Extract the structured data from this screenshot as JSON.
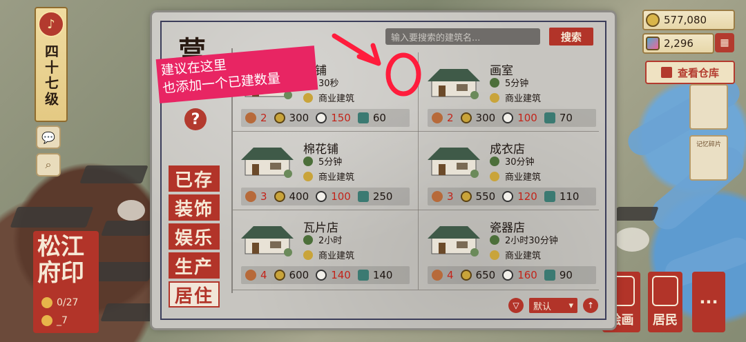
{
  "level": {
    "text": "四十七级"
  },
  "seal": {
    "title": "松江府印",
    "pop": "0/27",
    "other": "_7"
  },
  "resources": {
    "coins": "577,080",
    "gems": "2,296"
  },
  "warehouse": {
    "label": "查看仓库"
  },
  "right_cards": {
    "card2": "记忆碎片"
  },
  "bottom_buttons": {
    "paint": "绘画",
    "residents": "居民",
    "more": "···"
  },
  "panel": {
    "category_title": "营",
    "help": "?",
    "search_placeholder": "输入要搜索的建筑名...",
    "search_button": "搜索",
    "sort_label": "默认",
    "tabs": [
      "已存",
      "装饰",
      "娱乐",
      "生产",
      "居住"
    ]
  },
  "annotation": {
    "text": "建议在这里\n也添加一个已建数量"
  },
  "colors": {
    "accent": "#b23429",
    "annotation": "#e82563"
  },
  "cards": [
    {
      "name": "具铺",
      "time": "30秒",
      "type": "商业建筑",
      "workers": "2",
      "coins": "300",
      "bowls": "150",
      "item": "60",
      "item_icon": "ruler-icon"
    },
    {
      "name": "画室",
      "time": "5分钟",
      "type": "商业建筑",
      "workers": "2",
      "coins": "300",
      "bowls": "100",
      "item": "70",
      "item_icon": "scroll-icon"
    },
    {
      "name": "棉花铺",
      "time": "5分钟",
      "type": "商业建筑",
      "workers": "3",
      "coins": "400",
      "bowls": "100",
      "item": "250",
      "item_icon": "cotton-icon"
    },
    {
      "name": "成衣店",
      "time": "30分钟",
      "type": "商业建筑",
      "workers": "3",
      "coins": "550",
      "bowls": "120",
      "item": "110",
      "item_icon": "clothes-icon"
    },
    {
      "name": "瓦片店",
      "time": "2小时",
      "type": "商业建筑",
      "workers": "4",
      "coins": "600",
      "bowls": "140",
      "item": "140",
      "item_icon": "tile-icon"
    },
    {
      "name": "瓷器店",
      "time": "2小时30分钟",
      "type": "商业建筑",
      "workers": "4",
      "coins": "650",
      "bowls": "160",
      "item": "90",
      "item_icon": "vase-icon"
    }
  ]
}
